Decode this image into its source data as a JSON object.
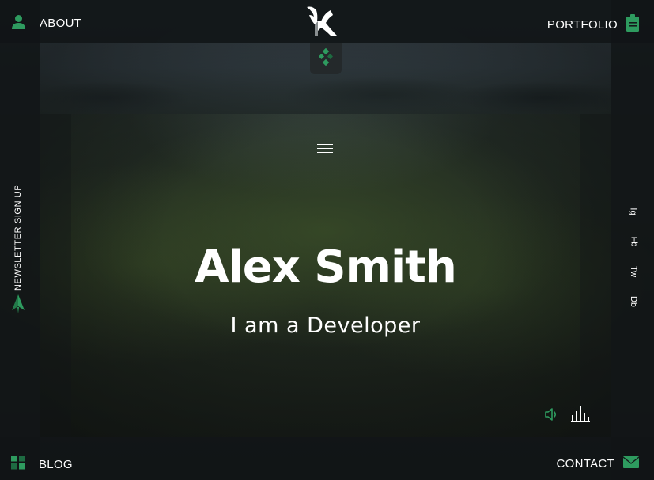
{
  "nav": {
    "about": "ABOUT",
    "portfolio": "PORTFOLIO",
    "blog": "BLOG",
    "contact": "CONTACT"
  },
  "hero": {
    "name": "Alex Smith",
    "role": "I am a Developer"
  },
  "sidebar": {
    "newsletter": "NEWSLETTER SIGN UP"
  },
  "social": [
    "Ig",
    "Fb",
    "Tw",
    "Db"
  ],
  "icons": {
    "about": "user-icon",
    "portfolio": "clipboard-icon",
    "blog": "grid-icon",
    "contact": "envelope-icon",
    "newsletter": "paper-plane-icon",
    "logo": "bird-logo",
    "toggle": "diamond-dots-icon",
    "menu": "hamburger-icon",
    "sound": "speaker-icon",
    "equalizer": "equalizer-icon"
  },
  "colors": {
    "accent": "#2e9b5f",
    "background": "#15191b",
    "text": "#ffffff"
  }
}
